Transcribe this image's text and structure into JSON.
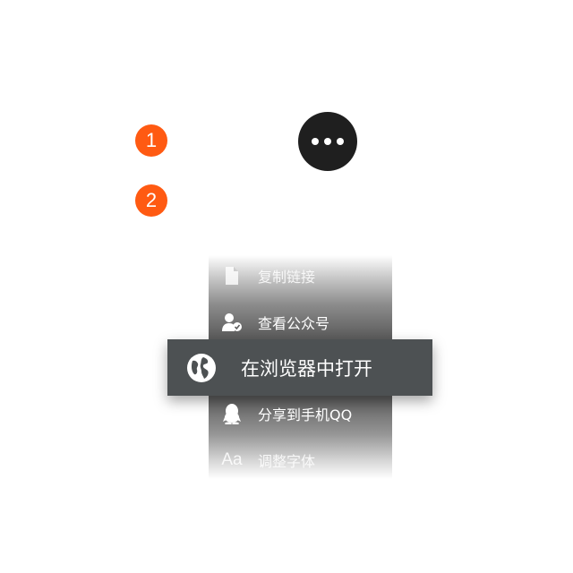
{
  "steps": [
    "1",
    "2"
  ],
  "more_button": {
    "icon": "more-horizontal-icon"
  },
  "menu": {
    "items": [
      {
        "label": "复制链接",
        "icon": "document-icon"
      },
      {
        "label": "查看公众号",
        "icon": "user-check-icon"
      },
      {
        "label": "在浏览器中打开",
        "icon": "globe-icon",
        "highlighted": true
      },
      {
        "label": "分享到手机QQ",
        "icon": "qq-penguin-icon"
      },
      {
        "label": "调整字体",
        "icon": "font-size-icon",
        "icon_text": "Aa"
      }
    ]
  },
  "colors": {
    "badge": "#ff5a12",
    "more_button": "#1f1f1f",
    "highlight": "#4d5153"
  }
}
